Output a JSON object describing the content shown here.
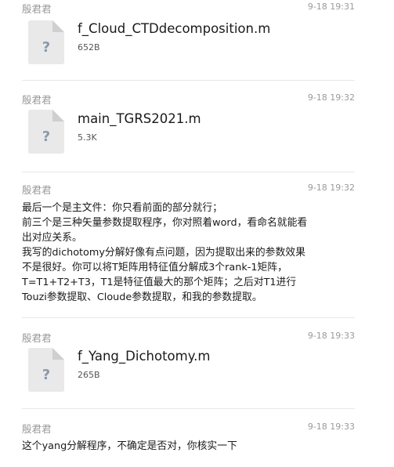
{
  "messages": [
    {
      "sender": "殷君君",
      "time": "9-18 19:31",
      "file": {
        "icon": "unknown-file-icon",
        "name": "f_Cloud_CTDdecomposition.m",
        "size": "652B"
      }
    },
    {
      "sender": "殷君君",
      "time": "9-18 19:32",
      "file": {
        "icon": "unknown-file-icon",
        "name": "main_TGRS2021.m",
        "size": "5.3K"
      }
    },
    {
      "sender": "殷君君",
      "time": "9-18 19:32",
      "lines": [
        "最后一个是主文件：你只看前面的部分就行；",
        "前三个是三种矢量参数提取程序，你对照着word，看命名就能看",
        "出对应关系。",
        "我写的dichotomy分解好像有点问题，因为提取出来的参数效果",
        "不是很好。你可以将T矩阵用特征值分解成3个rank-1矩阵，",
        "T=T1+T2+T3，T1是特征值最大的那个矩阵；之后对T1进行",
        "Touzi参数提取、Cloude参数提取，和我的参数提取。"
      ]
    },
    {
      "sender": "殷君君",
      "time": "9-18 19:33",
      "file": {
        "icon": "unknown-file-icon",
        "name": "f_Yang_Dichotomy.m",
        "size": "265B"
      }
    },
    {
      "sender": "殷君君",
      "time": "9-18 19:33",
      "lines": [
        "这个yang分解程序，不确定是否对，你核实一下"
      ]
    }
  ]
}
